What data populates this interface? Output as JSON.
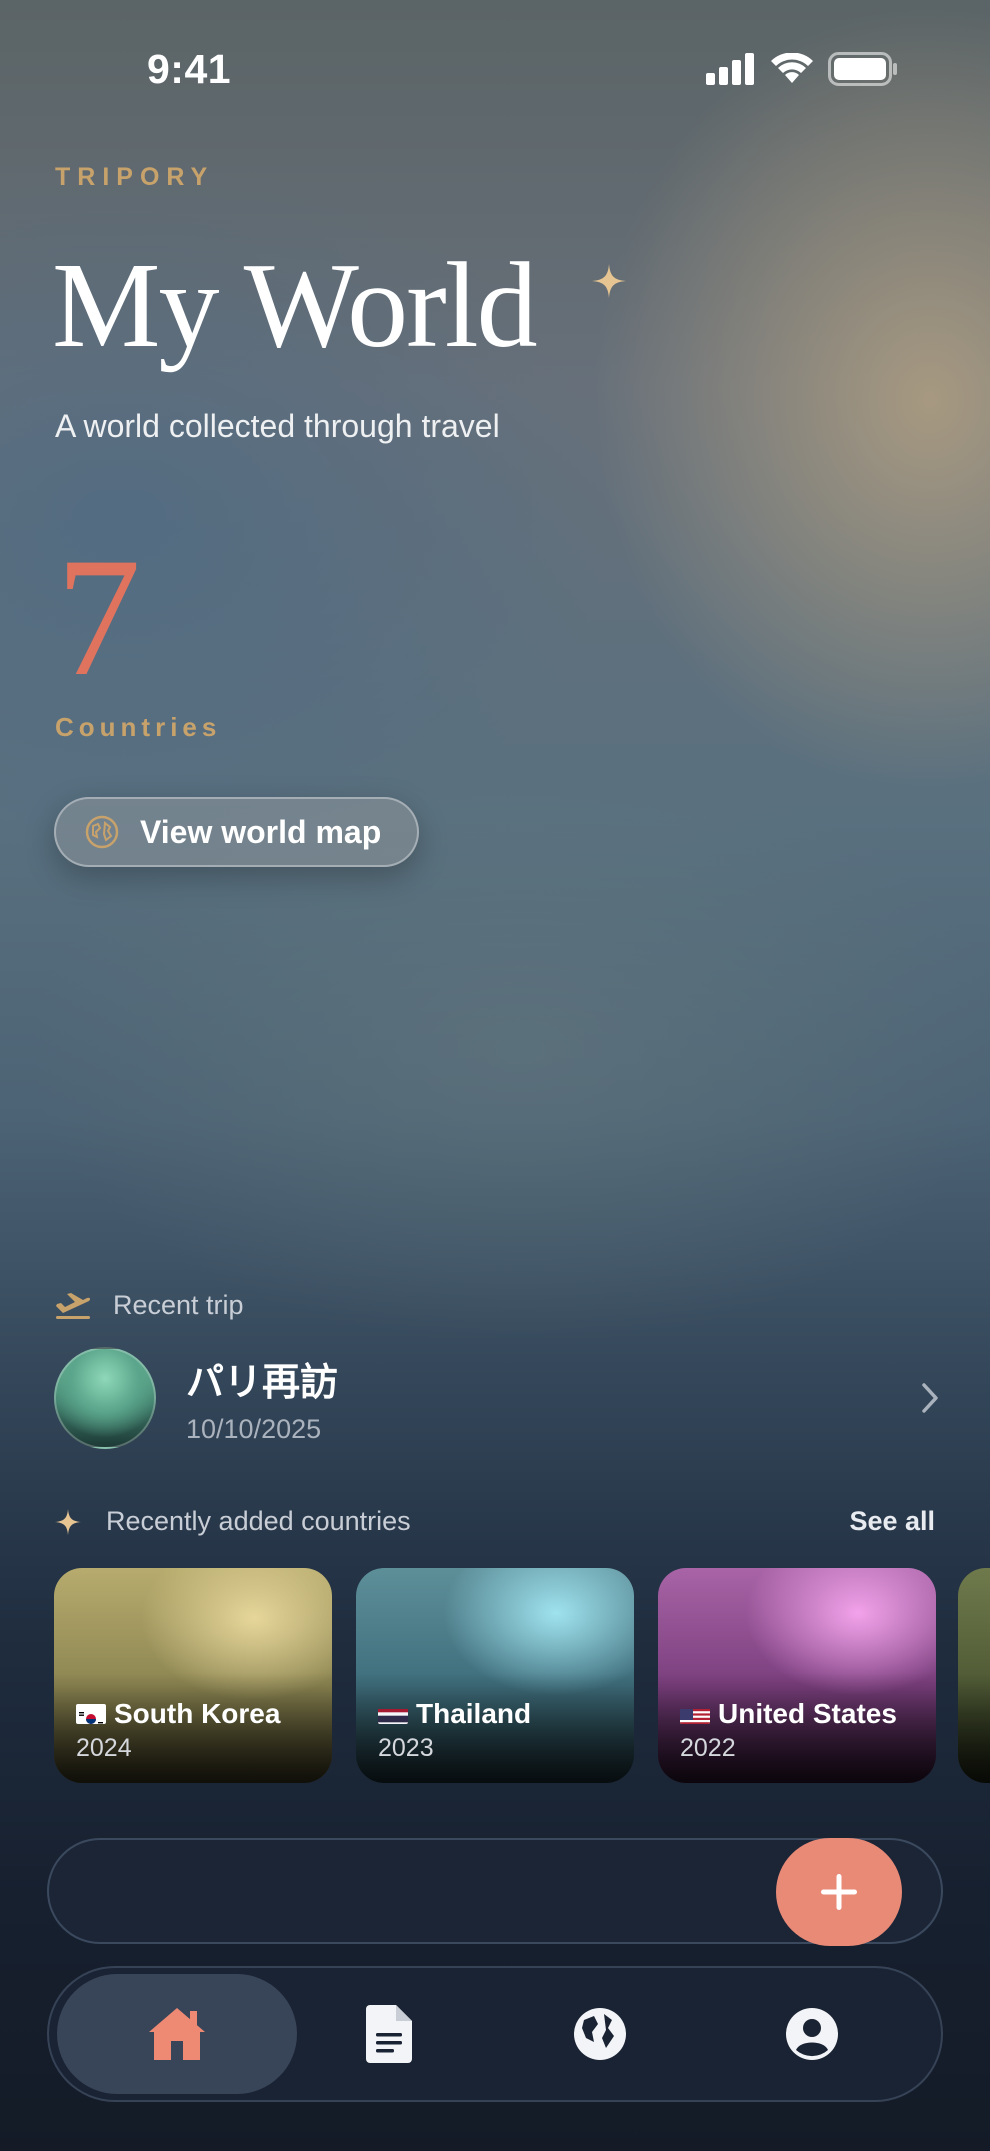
{
  "status_bar": {
    "time": "9:41",
    "icons": [
      "signal-icon",
      "wifi-icon",
      "battery-icon"
    ]
  },
  "header": {
    "brand": "TRIPORY",
    "title": "My World",
    "subtitle": "A world collected through travel"
  },
  "stats": {
    "count": "7",
    "label": "Countries"
  },
  "map_button": {
    "label": "View world map",
    "icon": "globe-outline-icon"
  },
  "recent_trip": {
    "section_label": "Recent trip",
    "icon": "airplane-departure-icon",
    "name": "パリ再訪",
    "date": "10/10/2025"
  },
  "recently_added": {
    "section_label": "Recently added countries",
    "see_all": "See all",
    "countries": [
      {
        "name": "South Korea",
        "year": "2024",
        "flag": "south-korea-flag"
      },
      {
        "name": "Thailand",
        "year": "2023",
        "flag": "thailand-flag"
      },
      {
        "name": "United States",
        "year": "2022",
        "flag": "united-states-flag"
      }
    ]
  },
  "tabs": [
    {
      "icon": "home-icon",
      "active": true
    },
    {
      "icon": "document-icon",
      "active": false
    },
    {
      "icon": "globe-icon",
      "active": false
    },
    {
      "icon": "profile-icon",
      "active": false
    }
  ],
  "colors": {
    "accent_gold": "#c8a26b",
    "accent_coral": "#e0735e",
    "fab": "#e98a77",
    "tab_bar": "#1a2333"
  }
}
